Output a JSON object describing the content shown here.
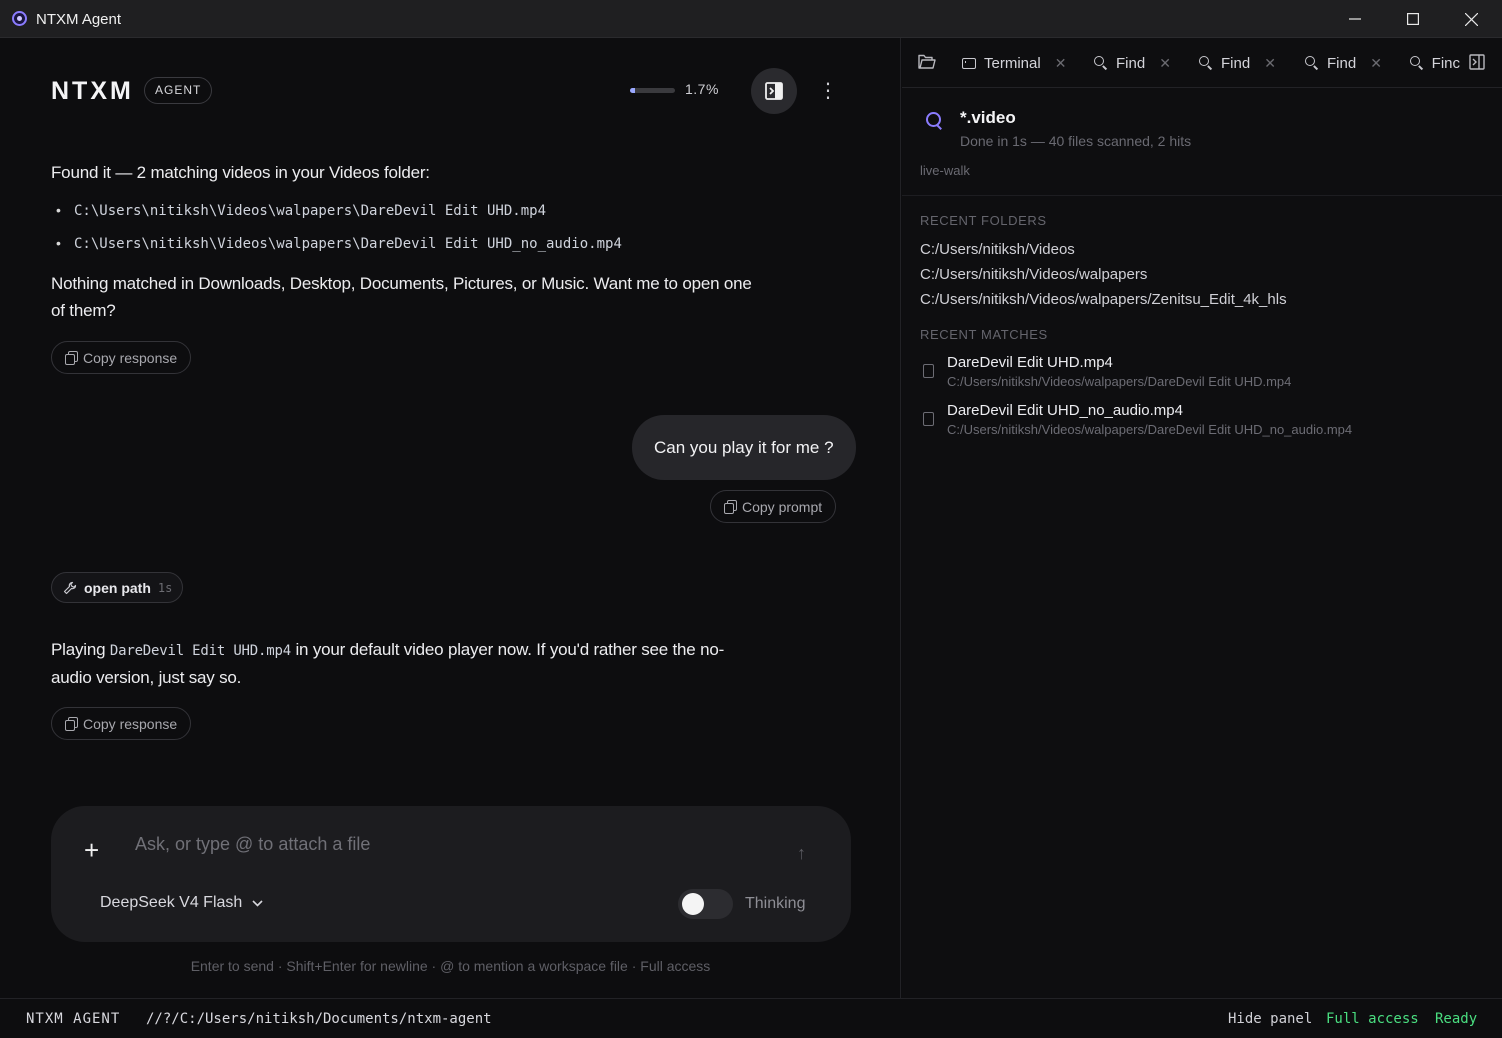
{
  "window": {
    "title": "NTXM Agent",
    "controls": [
      "—",
      "☐",
      "✕"
    ]
  },
  "header": {
    "brand": "NTXM",
    "badge": "AGENT",
    "context_usage": {
      "fraction": 0.017,
      "label": "1.7%"
    },
    "panel_toggle_icon": "panel-toggle-icon",
    "menu_icon": "⋮"
  },
  "messages": {
    "assistant1": {
      "intro": "Found it — 2 matching videos in your Videos folder:",
      "files": [
        "C:\\Users\\nitiksh\\Videos\\walpapers\\DareDevil Edit UHD.mp4",
        "C:\\Users\\nitiksh\\Videos\\walpapers\\DareDevil Edit UHD_no_audio.mp4"
      ],
      "outro_line1": "Nothing matched in Downloads, Desktop, Documents, Pictures, or Music. Want me to open one",
      "outro_line2": "of them?",
      "copy_label": "Copy response"
    },
    "user1": {
      "text": "Can you play it for me ?",
      "copy_label": "Copy prompt"
    },
    "tool_call": {
      "name": "open path",
      "duration": "1s"
    },
    "assistant2": {
      "prefix": "Playing",
      "code": "DareDevil Edit UHD.mp4",
      "suffix": "in your default video player now. If you'd rather see the no-",
      "line2": "audio version, just say so.",
      "copy_label": "Copy response"
    }
  },
  "composer": {
    "placeholder": "Ask, or type @ to attach a file",
    "plus": "+",
    "send_icon": "↑",
    "model": "DeepSeek V4 Flash",
    "thinking_label": "Thinking",
    "thinking_on": false,
    "hint": "Enter to send · Shift+Enter for newline · @ to mention a workspace file · Full access"
  },
  "side_panel": {
    "tabs": [
      {
        "label": "Terminal",
        "icon": "terminal-icon"
      },
      {
        "label": "Find",
        "icon": "search-icon"
      },
      {
        "label": "Find",
        "icon": "search-icon"
      },
      {
        "label": "Find",
        "icon": "search-icon"
      },
      {
        "label": "Finc",
        "icon": "search-icon"
      }
    ],
    "search": {
      "query": "*.video",
      "status": "Done in 1s — 40 files scanned, 2 hits",
      "mode": "live-walk"
    },
    "recent_folders_title": "RECENT FOLDERS",
    "recent_folders": [
      "C:/Users/nitiksh/Videos",
      "C:/Users/nitiksh/Videos/walpapers",
      "C:/Users/nitiksh/Videos/walpapers/Zenitsu_Edit_4k_hls"
    ],
    "recent_matches_title": "RECENT MATCHES",
    "recent_matches": [
      {
        "name": "DareDevil Edit UHD.mp4",
        "path": "C:/Users/nitiksh/Videos/walpapers/DareDevil Edit UHD.mp4"
      },
      {
        "name": "DareDevil Edit UHD_no_audio.mp4",
        "path": "C:/Users/nitiksh/Videos/walpapers/DareDevil Edit UHD_no_audio.mp4"
      }
    ]
  },
  "statusbar": {
    "app": "NTXM AGENT",
    "path": "//?/C:/Users/nitiksh/Documents/ntxm-agent",
    "hide_panel": "Hide panel",
    "access": "Full access",
    "status": "Ready"
  },
  "colors": {
    "accent": "#8b7cff",
    "status_green": "#4ade80",
    "background": "#0d0d0f"
  }
}
